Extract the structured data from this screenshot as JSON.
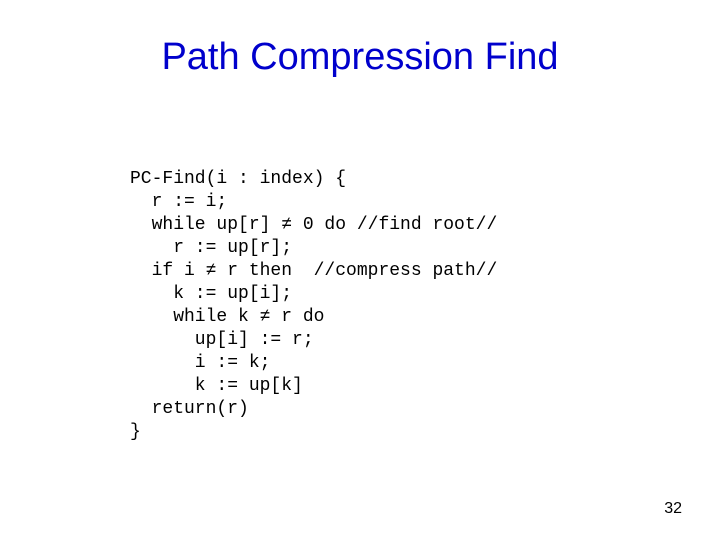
{
  "slide": {
    "title": "Path Compression Find",
    "code": "PC-Find(i : index) {\n  r := i;\n  while up[r] ≠ 0 do //find root//\n    r := up[r];\n  if i ≠ r then  //compress path//\n    k := up[i];\n    while k ≠ r do\n      up[i] := r;\n      i := k;\n      k := up[k]\n  return(r)\n}",
    "page_number": "32"
  }
}
